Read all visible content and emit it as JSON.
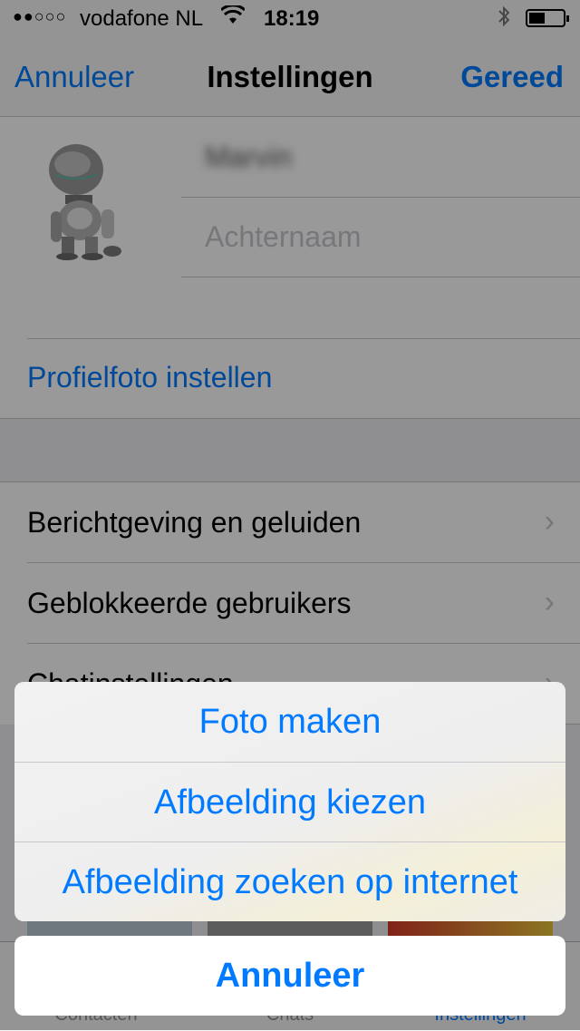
{
  "status_bar": {
    "signal": "●●○○○",
    "carrier": "vodafone NL",
    "time": "18:19",
    "wifi_icon": "wifi-icon",
    "bluetooth_icon": "bluetooth-icon",
    "battery_icon": "battery-icon"
  },
  "nav": {
    "left": "Annuleer",
    "title": "Instellingen",
    "right": "Gereed"
  },
  "profile": {
    "avatar_icon": "robot-avatar",
    "first_name": "Marvin",
    "last_name_placeholder": "Achternaam",
    "set_photo_label": "Profielfoto instellen"
  },
  "settings_rows": [
    {
      "label": "Berichtgeving en geluiden"
    },
    {
      "label": "Geblokkeerde gebruikers"
    },
    {
      "label": "Chatinstellingen"
    }
  ],
  "tab_bar": {
    "tabs": [
      {
        "label": "Contacten"
      },
      {
        "label": "Chats"
      },
      {
        "label": "Instellingen"
      }
    ]
  },
  "action_sheet": {
    "options": [
      {
        "label": "Foto maken"
      },
      {
        "label": "Afbeelding kiezen"
      },
      {
        "label": "Afbeelding zoeken op internet"
      }
    ],
    "cancel_label": "Annuleer"
  },
  "colors": {
    "accent": "#007aff",
    "overlay": "rgba(0,0,0,0.40)"
  }
}
